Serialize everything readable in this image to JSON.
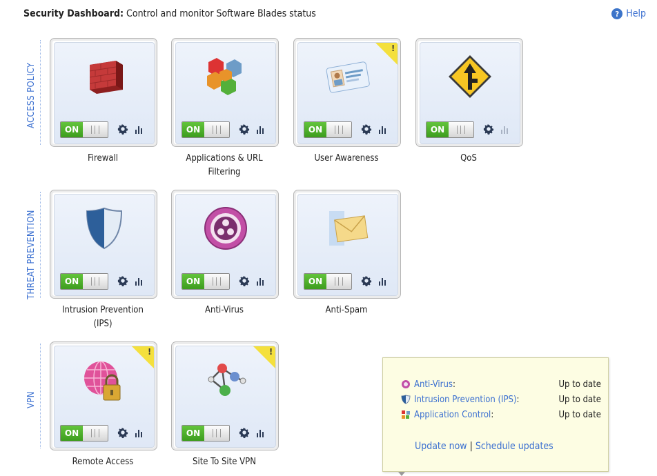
{
  "header": {
    "title_bold": "Security Dashboard:",
    "title_rest": " Control and monitor Software Blades status",
    "help_label": "Help",
    "help_icon": "question-circle-icon"
  },
  "sections": {
    "access_policy": "ACCESS POLICY",
    "threat_prevention": "THREAT PREVENTION",
    "vpn": "VPN"
  },
  "blades": {
    "firewall": {
      "name": "Firewall",
      "toggle": "ON",
      "icon": "brick-wall-icon",
      "warning": false
    },
    "app_url": {
      "name_line1": "Applications & URL",
      "name_line2": "Filtering",
      "toggle": "ON",
      "icon": "cubes-icon",
      "warning": false
    },
    "user_awareness": {
      "name": "User Awareness",
      "toggle": "ON",
      "icon": "id-card-icon",
      "warning": true,
      "warning_mark": "!"
    },
    "qos": {
      "name": "QoS",
      "toggle": "ON",
      "icon": "road-sign-icon",
      "warning": false
    },
    "ips": {
      "name_line1": "Intrusion Prevention",
      "name_line2": "(IPS)",
      "toggle": "ON",
      "icon": "shield-icon",
      "warning": false
    },
    "antivirus": {
      "name": "Anti-Virus",
      "toggle": "ON",
      "icon": "biohazard-icon",
      "warning": false
    },
    "antispam": {
      "name": "Anti-Spam",
      "toggle": "ON",
      "icon": "envelope-icon",
      "warning": false
    },
    "remote_access": {
      "name": "Remote Access",
      "toggle": "ON",
      "icon": "globe-lock-icon",
      "warning": true,
      "warning_mark": "!"
    },
    "site_vpn": {
      "name": "Site To Site VPN",
      "toggle": "ON",
      "icon": "network-nodes-icon",
      "warning": true,
      "warning_mark": "!"
    }
  },
  "tooltip": {
    "rows": [
      {
        "label": "Anti-Virus",
        "colon": ":",
        "status": "Up to date"
      },
      {
        "label": "Intrusion Prevention (IPS)",
        "colon": ":",
        "status": "Up to date"
      },
      {
        "label": "Application Control",
        "colon": ":",
        "status": "Up to date"
      }
    ],
    "update_now": "Update now",
    "separator": "|",
    "schedule": "Schedule updates"
  },
  "colors": {
    "accent": "#3a6fd0",
    "toggle_on": "#4caf2a",
    "warning": "#f4e03d",
    "tooltip_bg": "#fdfde3"
  }
}
